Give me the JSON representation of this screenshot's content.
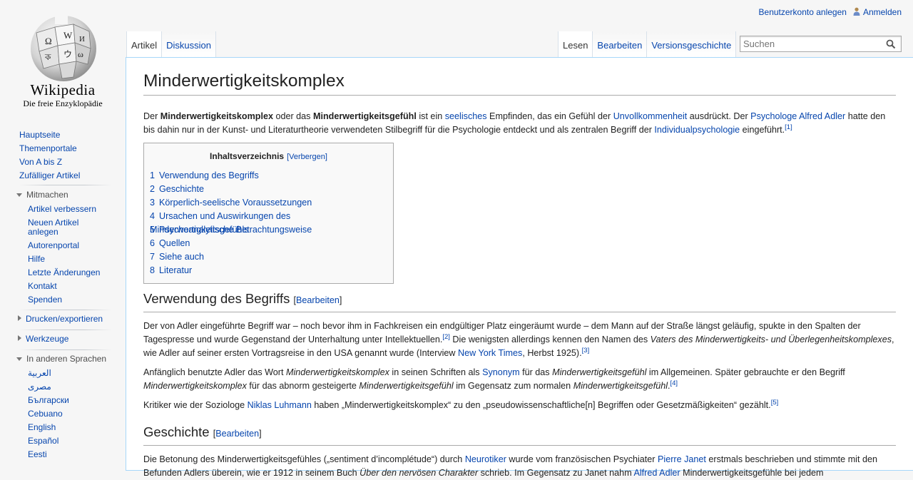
{
  "logo": {
    "wordmark": "Wikipedia",
    "tagline": "Die freie Enzyklopädie"
  },
  "personal": {
    "create_account": "Benutzerkonto anlegen",
    "login": "Anmelden"
  },
  "tabs_left": [
    "Artikel",
    "Diskussion"
  ],
  "tabs_right": [
    "Lesen",
    "Bearbeiten",
    "Versionsgeschichte"
  ],
  "search": {
    "placeholder": "Suchen"
  },
  "sidebar": {
    "nav": [
      "Hauptseite",
      "Themenportale",
      "Von A bis Z",
      "Zufälliger Artikel"
    ],
    "mitmachen": {
      "heading": "Mitmachen",
      "items": [
        "Artikel verbessern",
        "Neuen Artikel anlegen",
        "Autorenportal",
        "Hilfe",
        "Letzte Änderungen",
        "Kontakt",
        "Spenden"
      ]
    },
    "drucken": "Drucken/exportieren",
    "werkzeuge": "Werkzeuge",
    "sprachen": {
      "heading": "In anderen Sprachen",
      "items": [
        "العربية",
        "مصرى",
        "Български",
        "Cebuano",
        "English",
        "Español",
        "Eesti"
      ]
    }
  },
  "article": {
    "title": "Minderwertigkeitskomplex",
    "intro": {
      "t1": "Der ",
      "b1": "Minderwertigkeitskomplex",
      "t2": " oder das ",
      "b2": "Minderwertigkeitsgefühl",
      "t3": " ist ein ",
      "l1": "seelisches",
      "t4": " Empfinden, das ein Gefühl der ",
      "l2": "Unvollkommenheit",
      "t5": " ausdrückt. Der ",
      "l3": "Psychologe",
      "t6": " ",
      "l4": "Alfred Adler",
      "t7": " hatte den bis dahin nur in der Kunst- und Literaturtheorie verwendeten Stilbegriff für die Psychologie entdeckt und als zentralen Begriff der ",
      "l5": "Individualpsychologie",
      "t8": " eingeführt.",
      "ref": "[1]"
    },
    "toc": {
      "title": "Inhaltsverzeichnis",
      "toggle": "[Verbergen]",
      "items": [
        {
          "num": "1",
          "label": "Verwendung des Begriffs"
        },
        {
          "num": "2",
          "label": "Geschichte"
        },
        {
          "num": "3",
          "label": "Körperlich-seelische Voraussetzungen"
        },
        {
          "num": "4",
          "label": "Ursachen und Auswirkungen des Minderwertigkeitsgefühls"
        },
        {
          "num": "5",
          "label": "Psychoanalytische Betrachtungsweise"
        },
        {
          "num": "6",
          "label": "Quellen"
        },
        {
          "num": "7",
          "label": "Siehe auch"
        },
        {
          "num": "8",
          "label": "Literatur"
        }
      ]
    },
    "section1": {
      "heading": "Verwendung des Begriffs",
      "edit_open": "[",
      "edit": "Bearbeiten",
      "edit_close": "]",
      "p1": {
        "t1": "Der von Adler eingeführte Begriff war – noch bevor ihm in Fachkreisen ein endgültiger Platz eingeräumt wurde – dem Mann auf der Straße längst geläufig, spukte in den Spalten der Tagespresse und wurde Gegenstand der Unterhaltung unter Intellektuellen.",
        "ref1": "[2]",
        "t2": " Die wenigsten allerdings kennen den Namen des ",
        "i1": "Vaters des Minderwertigkeits- und Überlegenheitskomplexes",
        "t3": ", wie Adler auf seiner ersten Vortragsreise in den USA genannt wurde (Interview ",
        "l1": "New York Times",
        "t4": ", Herbst 1925).",
        "ref2": "[3]"
      },
      "p2": {
        "t1": "Anfänglich benutzte Adler das Wort ",
        "i1": "Minderwertigkeitskomplex",
        "t2": " in seinen Schriften als ",
        "l1": "Synonym",
        "t3": " für das ",
        "i2": "Minderwertigkeitsgefühl",
        "t4": " im Allgemeinen. Später gebrauchte er den Begriff ",
        "i3": "Minderwertigkeitskomplex",
        "t5": " für das abnorm gesteigerte ",
        "i4": "Minderwertigkeitsgefühl",
        "t6": " im Gegensatz zum normalen ",
        "i5": "Minderwertigkeitsgefühl",
        "t7": ".",
        "ref": "[4]"
      },
      "p3": {
        "t1": "Kritiker wie der Soziologe ",
        "l1": "Niklas Luhmann",
        "t2": " haben „Minderwertigkeitskomplex“ zu den „pseudowissenschaftliche[n] Begriffen oder Gesetzmäßigkeiten“ gezählt.",
        "ref": "[5]"
      }
    },
    "section2": {
      "heading": "Geschichte",
      "edit_open": "[",
      "edit": "Bearbeiten",
      "edit_close": "]",
      "p1": {
        "t1": "Die Betonung des Minderwertigkeitsgefühles („sentiment d’incomplétude“) durch ",
        "l1": "Neurotiker",
        "t2": " wurde vom französischen Psychiater ",
        "l2": "Pierre Janet",
        "t3": " erstmals beschrieben und stimmte mit den Befunden Adlers überein, wie er 1912 in seinem Buch ",
        "i1": "Über den nervösen Charakter",
        "t4": " schrieb. Im Gegensatz zu Janet nahm ",
        "l3": "Alfred Adler",
        "t5": " Minderwertigkeitsgefühle bei jedem"
      }
    }
  }
}
